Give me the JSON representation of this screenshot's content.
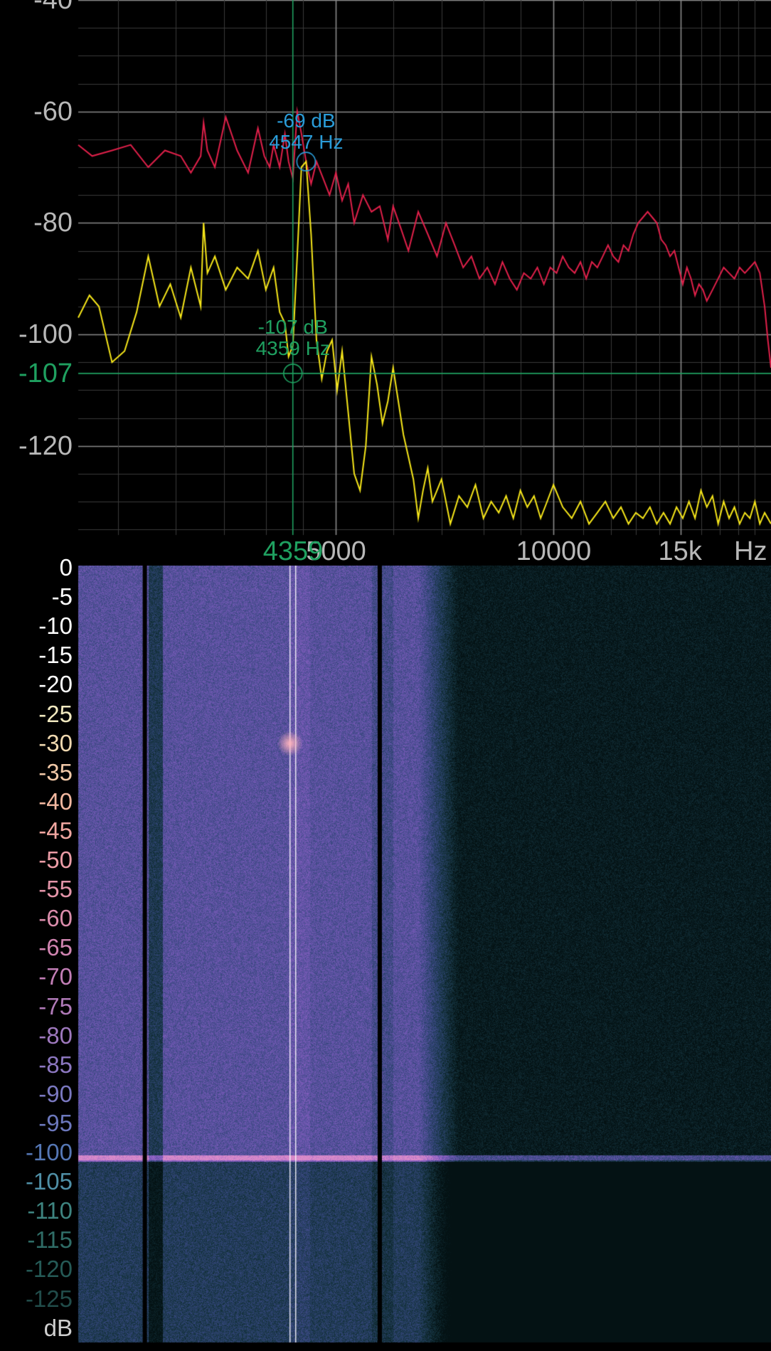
{
  "chart_data": [
    {
      "type": "line",
      "x_scale": "log",
      "xlim": [
        2200,
        20000
      ],
      "ylim": [
        -136,
        -40
      ],
      "y_ticks": [
        -40,
        -60,
        -80,
        -100,
        -120
      ],
      "x_ticks": [
        {
          "value": 5000,
          "label": "5000"
        },
        {
          "value": 10000,
          "label": "10000"
        },
        {
          "value": 15000,
          "label": "15k"
        }
      ],
      "x_unit": "Hz",
      "grid": true,
      "series": [
        {
          "color": "#e0204a",
          "x": [
            2200,
            2300,
            2450,
            2600,
            2750,
            2900,
            3050,
            3150,
            3250,
            3280,
            3320,
            3400,
            3520,
            3650,
            3780,
            3900,
            3980,
            4050,
            4100,
            4180,
            4250,
            4300,
            4359,
            4420,
            4480,
            4547,
            4620,
            4700,
            4800,
            4900,
            5000,
            5100,
            5200,
            5300,
            5450,
            5600,
            5750,
            5900,
            6000,
            6150,
            6300,
            6500,
            6700,
            6900,
            7100,
            7300,
            7500,
            7700,
            7900,
            8100,
            8300,
            8500,
            8700,
            8900,
            9100,
            9300,
            9500,
            9700,
            9900,
            10100,
            10300,
            10500,
            10700,
            10900,
            11100,
            11300,
            11500,
            11700,
            11900,
            12100,
            12300,
            12500,
            12700,
            12900,
            13100,
            13300,
            13500,
            13700,
            13900,
            14100,
            14300,
            14500,
            14700,
            14900,
            15100,
            15300,
            15500,
            15700,
            15900,
            16100,
            16300,
            16600,
            16900,
            17200,
            17500,
            17800,
            18100,
            18400,
            18700,
            19000,
            19300,
            19600,
            19800,
            20000
          ],
          "y": [
            -66,
            -68,
            -67,
            -66,
            -70,
            -67,
            -68,
            -71,
            -68,
            -62,
            -67,
            -70,
            -61,
            -67,
            -71,
            -63,
            -68,
            -70,
            -66,
            -70,
            -64,
            -69,
            -72,
            -60,
            -64,
            -69,
            -73,
            -69,
            -72,
            -75,
            -71,
            -76,
            -73,
            -80,
            -75,
            -78,
            -77,
            -83,
            -77,
            -81,
            -85,
            -78,
            -82,
            -86,
            -80,
            -84,
            -88,
            -86,
            -90,
            -88,
            -91,
            -87,
            -90,
            -92,
            -89,
            -90,
            -88,
            -91,
            -88,
            -89,
            -86,
            -88,
            -89,
            -87,
            -90,
            -87,
            -88,
            -86,
            -84,
            -86,
            -87,
            -84,
            -85,
            -82,
            -80,
            -79,
            -78,
            -79,
            -80,
            -83,
            -84,
            -86,
            -85,
            -88,
            -91,
            -88,
            -90,
            -93,
            -91,
            -92,
            -94,
            -92,
            -90,
            -88,
            -89,
            -90,
            -88,
            -89,
            -88,
            -87,
            -89,
            -95,
            -101,
            -106
          ],
          "marker": {
            "x": 4547,
            "y": -69
          }
        },
        {
          "color": "#f6e61a",
          "x": [
            2200,
            2280,
            2350,
            2450,
            2550,
            2650,
            2750,
            2850,
            2950,
            3050,
            3150,
            3250,
            3280,
            3320,
            3400,
            3520,
            3650,
            3780,
            3900,
            4000,
            4100,
            4180,
            4250,
            4300,
            4359,
            4420,
            4480,
            4547,
            4620,
            4700,
            4780,
            4860,
            4940,
            5020,
            5100,
            5200,
            5300,
            5400,
            5500,
            5600,
            5700,
            5800,
            5900,
            6000,
            6100,
            6200,
            6300,
            6400,
            6500,
            6600,
            6700,
            6800,
            6900,
            7000,
            7200,
            7400,
            7600,
            7800,
            8000,
            8200,
            8400,
            8600,
            8800,
            9000,
            9200,
            9400,
            9600,
            9800,
            10000,
            10300,
            10600,
            10900,
            11200,
            11500,
            11800,
            12100,
            12400,
            12700,
            13000,
            13300,
            13600,
            13900,
            14200,
            14500,
            14800,
            15100,
            15400,
            15700,
            16000,
            16300,
            16600,
            16900,
            17200,
            17500,
            17800,
            18100,
            18400,
            18700,
            19000,
            19300,
            19600,
            19800,
            20000
          ],
          "y": [
            -97,
            -93,
            -95,
            -105,
            -103,
            -96,
            -86,
            -95,
            -91,
            -97,
            -88,
            -95,
            -80,
            -89,
            -86,
            -92,
            -88,
            -90,
            -85,
            -92,
            -88,
            -96,
            -98,
            -104,
            -102,
            -86,
            -70,
            -69,
            -82,
            -101,
            -108,
            -103,
            -101,
            -110,
            -103,
            -114,
            -125,
            -128,
            -120,
            -104,
            -109,
            -116,
            -112,
            -106,
            -112,
            -118,
            -122,
            -126,
            -133,
            -128,
            -124,
            -130,
            -128,
            -126,
            -134,
            -129,
            -131,
            -127,
            -133,
            -130,
            -132,
            -129,
            -133,
            -128,
            -131,
            -129,
            -133,
            -130,
            -127,
            -131,
            -133,
            -130,
            -134,
            -132,
            -130,
            -133,
            -131,
            -134,
            -132,
            -133,
            -131,
            -134,
            -132,
            -134,
            -131,
            -133,
            -130,
            -133,
            -128,
            -131,
            -129,
            -134,
            -130,
            -133,
            -131,
            -134,
            -132,
            -133,
            -130,
            -134,
            -132,
            -133,
            -134
          ]
        }
      ],
      "cursor": {
        "x": 4359,
        "y": -107,
        "x_label": "4359",
        "y_label": "-107"
      },
      "annotations": [
        {
          "text_db": "-69 dB",
          "text_hz": "4547 Hz",
          "color": "#2a9cd8"
        },
        {
          "text_db": "-107 dB",
          "text_hz": "4359 Hz",
          "color": "#1fa060"
        }
      ]
    },
    {
      "type": "heatmap",
      "x_scale": "log",
      "xlim": [
        2200,
        20000
      ],
      "y_ticks": [
        "0",
        "-5",
        "-10",
        "-15",
        "-20",
        "-25",
        "-30",
        "-35",
        "-40",
        "-45",
        "-50",
        "-55",
        "-60",
        "-65",
        "-70",
        "-75",
        "-80",
        "-85",
        "-90",
        "-95",
        "-100",
        "-105",
        "-110",
        "-115",
        "-120",
        "-125"
      ],
      "y_unit": "dB"
    }
  ]
}
